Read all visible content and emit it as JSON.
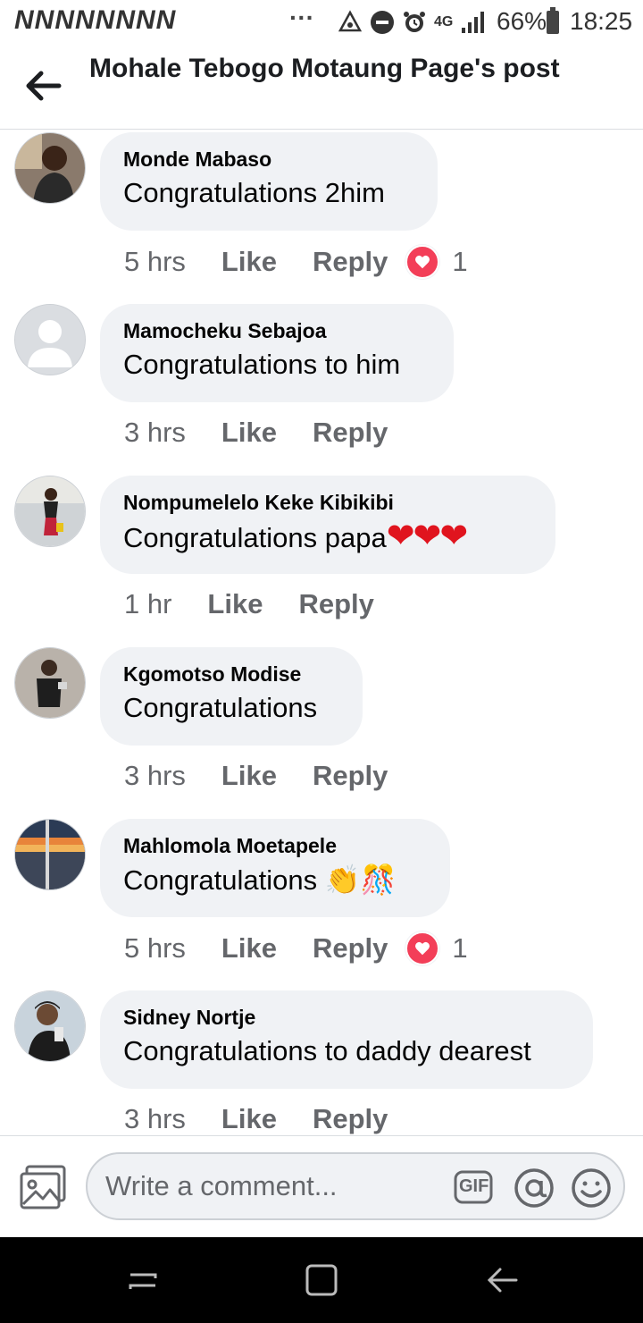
{
  "status_bar": {
    "notif_glyphs": "NNNNNNNN",
    "more": "···",
    "network": "4G",
    "battery": "66%",
    "time": "18:25"
  },
  "header": {
    "title": "Mohale Tebogo Motaung Page's post"
  },
  "comments": [
    {
      "author": "Monde Mabaso",
      "text": "Congratulations 2him",
      "emoji": "",
      "time": "5 hrs",
      "like": "Like",
      "reply": "Reply",
      "reactions": "1"
    },
    {
      "author": "Mamocheku Sebajoa",
      "text": "Congratulations to him",
      "emoji": "",
      "time": "3 hrs",
      "like": "Like",
      "reply": "Reply",
      "reactions": ""
    },
    {
      "author": "Nompumelelo Keke Kibikibi",
      "text": "Congratulations papa",
      "emoji": "❤❤❤",
      "time": "1 hr",
      "like": "Like",
      "reply": "Reply",
      "reactions": ""
    },
    {
      "author": "Kgomotso Modise",
      "text": "Congratulations",
      "emoji": "",
      "time": "3 hrs",
      "like": "Like",
      "reply": "Reply",
      "reactions": ""
    },
    {
      "author": "Mahlomola Moetapele",
      "text": "Congratulations ",
      "emoji": "👏🎊",
      "time": "5 hrs",
      "like": "Like",
      "reply": "Reply",
      "reactions": "1"
    },
    {
      "author": "Sidney Nortje",
      "text": "Congratulations to daddy dearest",
      "emoji": "",
      "time": "3 hrs",
      "like": "Like",
      "reply": "Reply",
      "reactions": ""
    }
  ],
  "composer": {
    "placeholder": "Write a comment...",
    "gif_label": "GIF"
  },
  "colors": {
    "bubble": "#f0f2f5",
    "meta": "#65676b",
    "heart": "#f33e58"
  }
}
